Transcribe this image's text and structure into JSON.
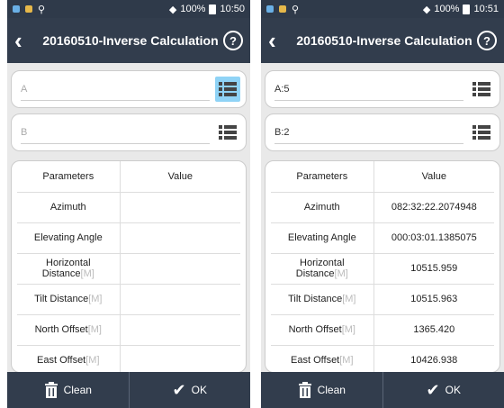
{
  "screens": [
    {
      "status": {
        "battery": "100%",
        "time": "10:50"
      },
      "app_title": "20160510-Inverse Calculation",
      "help_label": "?",
      "input_a": {
        "placeholder": "A",
        "value": ""
      },
      "input_b": {
        "placeholder": "B",
        "value": ""
      },
      "table": {
        "headers": [
          "Parameters",
          "Value"
        ],
        "rows": [
          {
            "param": "Azimuth",
            "unit": "",
            "value": ""
          },
          {
            "param": "Elevating Angle",
            "unit": "",
            "value": ""
          },
          {
            "param": "Horizontal Distance",
            "unit": "[M]",
            "value": ""
          },
          {
            "param": "Tilt Distance",
            "unit": "[M]",
            "value": ""
          },
          {
            "param": "North Offset",
            "unit": "[M]",
            "value": ""
          },
          {
            "param": "East Offset",
            "unit": "[M]",
            "value": ""
          }
        ]
      },
      "buttons": {
        "clean": "Clean",
        "ok": "OK"
      }
    },
    {
      "status": {
        "battery": "100%",
        "time": "10:51"
      },
      "app_title": "20160510-Inverse Calculation",
      "help_label": "?",
      "input_a": {
        "placeholder": "A",
        "value": "A:5"
      },
      "input_b": {
        "placeholder": "B",
        "value": "B:2"
      },
      "table": {
        "headers": [
          "Parameters",
          "Value"
        ],
        "rows": [
          {
            "param": "Azimuth",
            "unit": "",
            "value": "082:32:22.2074948"
          },
          {
            "param": "Elevating Angle",
            "unit": "",
            "value": "000:03:01.1385075"
          },
          {
            "param": "Horizontal Distance",
            "unit": "[M]",
            "value": "10515.959"
          },
          {
            "param": "Tilt Distance",
            "unit": "[M]",
            "value": "10515.963"
          },
          {
            "param": "North Offset",
            "unit": "[M]",
            "value": "1365.420"
          },
          {
            "param": "East Offset",
            "unit": "[M]",
            "value": "10426.938"
          }
        ]
      },
      "buttons": {
        "clean": "Clean",
        "ok": "OK"
      }
    }
  ],
  "colors": {
    "appbar": "#323d4d",
    "statusbar": "#2f3a4a",
    "active_list_button": "#8fd3f6",
    "background": "#e9e9e9"
  }
}
